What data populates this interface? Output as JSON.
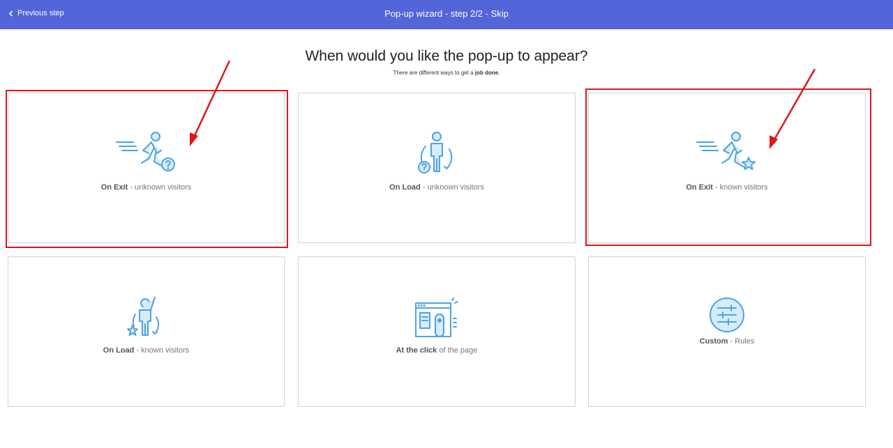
{
  "topbar": {
    "back_label": "Previous step",
    "title": "Pop-up wizard - step 2/2 - Skip"
  },
  "main": {
    "heading": "When would you like the pop-up to appear?",
    "subheading_prefix": "There are different ways to get a ",
    "subheading_bold": "job done",
    "subheading_suffix": "."
  },
  "options": [
    {
      "strong": "On Exit",
      "rest": " - unknown visitors",
      "icon": "running-person-question-icon",
      "highlighted": true
    },
    {
      "strong": "On Load",
      "rest": " - unknown visitors",
      "icon": "standing-person-question-icon",
      "highlighted": false
    },
    {
      "strong": "On Exit",
      "rest": " - known visitors",
      "icon": "running-person-star-icon",
      "highlighted": true
    },
    {
      "strong": "On Load",
      "rest": " - known visitors",
      "icon": "waving-person-star-icon",
      "highlighted": false
    },
    {
      "strong": "At the click",
      "rest": " of the page",
      "icon": "browser-click-icon",
      "highlighted": false
    },
    {
      "strong": "Custom",
      "rest": " - Rules",
      "icon": "sliders-icon",
      "highlighted": false
    }
  ],
  "colors": {
    "topbar": "#5265d9",
    "icon_stroke": "#4da3e0",
    "icon_fill": "#d6ecfa",
    "annotation": "#e0161b"
  }
}
